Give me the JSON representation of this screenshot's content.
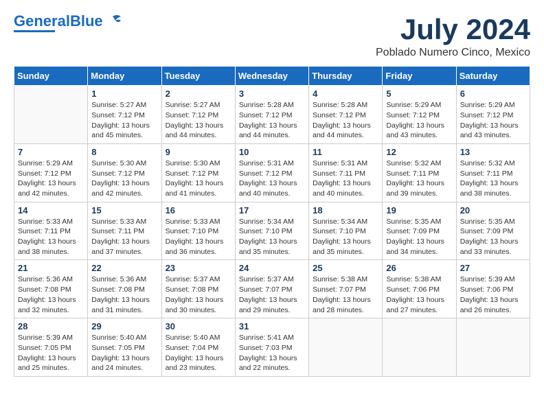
{
  "header": {
    "logo_line1": "General",
    "logo_line2": "Blue",
    "month": "July 2024",
    "location": "Poblado Numero Cinco, Mexico"
  },
  "weekdays": [
    "Sunday",
    "Monday",
    "Tuesday",
    "Wednesday",
    "Thursday",
    "Friday",
    "Saturday"
  ],
  "weeks": [
    [
      {
        "day": "",
        "info": ""
      },
      {
        "day": "1",
        "info": "Sunrise: 5:27 AM\nSunset: 7:12 PM\nDaylight: 13 hours\nand 45 minutes."
      },
      {
        "day": "2",
        "info": "Sunrise: 5:27 AM\nSunset: 7:12 PM\nDaylight: 13 hours\nand 44 minutes."
      },
      {
        "day": "3",
        "info": "Sunrise: 5:28 AM\nSunset: 7:12 PM\nDaylight: 13 hours\nand 44 minutes."
      },
      {
        "day": "4",
        "info": "Sunrise: 5:28 AM\nSunset: 7:12 PM\nDaylight: 13 hours\nand 44 minutes."
      },
      {
        "day": "5",
        "info": "Sunrise: 5:29 AM\nSunset: 7:12 PM\nDaylight: 13 hours\nand 43 minutes."
      },
      {
        "day": "6",
        "info": "Sunrise: 5:29 AM\nSunset: 7:12 PM\nDaylight: 13 hours\nand 43 minutes."
      }
    ],
    [
      {
        "day": "7",
        "info": "Sunrise: 5:29 AM\nSunset: 7:12 PM\nDaylight: 13 hours\nand 42 minutes."
      },
      {
        "day": "8",
        "info": "Sunrise: 5:30 AM\nSunset: 7:12 PM\nDaylight: 13 hours\nand 42 minutes."
      },
      {
        "day": "9",
        "info": "Sunrise: 5:30 AM\nSunset: 7:12 PM\nDaylight: 13 hours\nand 41 minutes."
      },
      {
        "day": "10",
        "info": "Sunrise: 5:31 AM\nSunset: 7:12 PM\nDaylight: 13 hours\nand 40 minutes."
      },
      {
        "day": "11",
        "info": "Sunrise: 5:31 AM\nSunset: 7:11 PM\nDaylight: 13 hours\nand 40 minutes."
      },
      {
        "day": "12",
        "info": "Sunrise: 5:32 AM\nSunset: 7:11 PM\nDaylight: 13 hours\nand 39 minutes."
      },
      {
        "day": "13",
        "info": "Sunrise: 5:32 AM\nSunset: 7:11 PM\nDaylight: 13 hours\nand 38 minutes."
      }
    ],
    [
      {
        "day": "14",
        "info": "Sunrise: 5:33 AM\nSunset: 7:11 PM\nDaylight: 13 hours\nand 38 minutes."
      },
      {
        "day": "15",
        "info": "Sunrise: 5:33 AM\nSunset: 7:11 PM\nDaylight: 13 hours\nand 37 minutes."
      },
      {
        "day": "16",
        "info": "Sunrise: 5:33 AM\nSunset: 7:10 PM\nDaylight: 13 hours\nand 36 minutes."
      },
      {
        "day": "17",
        "info": "Sunrise: 5:34 AM\nSunset: 7:10 PM\nDaylight: 13 hours\nand 35 minutes."
      },
      {
        "day": "18",
        "info": "Sunrise: 5:34 AM\nSunset: 7:10 PM\nDaylight: 13 hours\nand 35 minutes."
      },
      {
        "day": "19",
        "info": "Sunrise: 5:35 AM\nSunset: 7:09 PM\nDaylight: 13 hours\nand 34 minutes."
      },
      {
        "day": "20",
        "info": "Sunrise: 5:35 AM\nSunset: 7:09 PM\nDaylight: 13 hours\nand 33 minutes."
      }
    ],
    [
      {
        "day": "21",
        "info": "Sunrise: 5:36 AM\nSunset: 7:08 PM\nDaylight: 13 hours\nand 32 minutes."
      },
      {
        "day": "22",
        "info": "Sunrise: 5:36 AM\nSunset: 7:08 PM\nDaylight: 13 hours\nand 31 minutes."
      },
      {
        "day": "23",
        "info": "Sunrise: 5:37 AM\nSunset: 7:08 PM\nDaylight: 13 hours\nand 30 minutes."
      },
      {
        "day": "24",
        "info": "Sunrise: 5:37 AM\nSunset: 7:07 PM\nDaylight: 13 hours\nand 29 minutes."
      },
      {
        "day": "25",
        "info": "Sunrise: 5:38 AM\nSunset: 7:07 PM\nDaylight: 13 hours\nand 28 minutes."
      },
      {
        "day": "26",
        "info": "Sunrise: 5:38 AM\nSunset: 7:06 PM\nDaylight: 13 hours\nand 27 minutes."
      },
      {
        "day": "27",
        "info": "Sunrise: 5:39 AM\nSunset: 7:06 PM\nDaylight: 13 hours\nand 26 minutes."
      }
    ],
    [
      {
        "day": "28",
        "info": "Sunrise: 5:39 AM\nSunset: 7:05 PM\nDaylight: 13 hours\nand 25 minutes."
      },
      {
        "day": "29",
        "info": "Sunrise: 5:40 AM\nSunset: 7:05 PM\nDaylight: 13 hours\nand 24 minutes."
      },
      {
        "day": "30",
        "info": "Sunrise: 5:40 AM\nSunset: 7:04 PM\nDaylight: 13 hours\nand 23 minutes."
      },
      {
        "day": "31",
        "info": "Sunrise: 5:41 AM\nSunset: 7:03 PM\nDaylight: 13 hours\nand 22 minutes."
      },
      {
        "day": "",
        "info": ""
      },
      {
        "day": "",
        "info": ""
      },
      {
        "day": "",
        "info": ""
      }
    ]
  ]
}
